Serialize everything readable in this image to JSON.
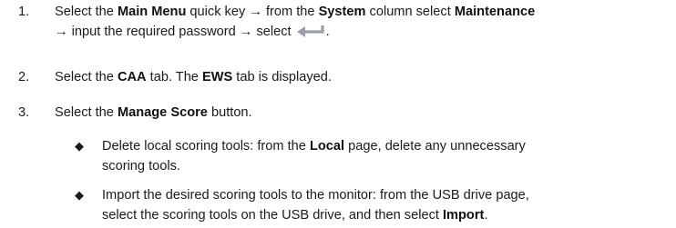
{
  "steps": [
    {
      "num": "1.",
      "line1": {
        "t1": "Select the ",
        "b1": "Main Menu",
        "t2": " quick key → from the ",
        "b2": "System",
        "t3": " column select ",
        "b3": "Maintenance"
      },
      "line2": {
        "t1": "→ input the required password → select",
        "t2": "."
      },
      "icon": "enter-key-icon"
    },
    {
      "num": "2.",
      "t1": "Select the ",
      "b1": "CAA",
      "t2": " tab. The ",
      "b2": "EWS",
      "t3": " tab is displayed."
    },
    {
      "num": "3.",
      "t1": "Select the ",
      "b1": "Manage Score",
      "t2": " button."
    }
  ],
  "bullets": [
    {
      "mark": "◆",
      "line1": {
        "t1": "Delete local scoring tools: from the ",
        "b1": "Local",
        "t2": " page, delete any unnecessary"
      },
      "line2": "scoring tools."
    },
    {
      "mark": "◆",
      "line1": "Import the desired scoring tools to the monitor: from the USB drive page,",
      "line2": {
        "t1": "select the scoring tools on the USB drive, and then select ",
        "b1": "Import",
        "t2": "."
      }
    }
  ]
}
